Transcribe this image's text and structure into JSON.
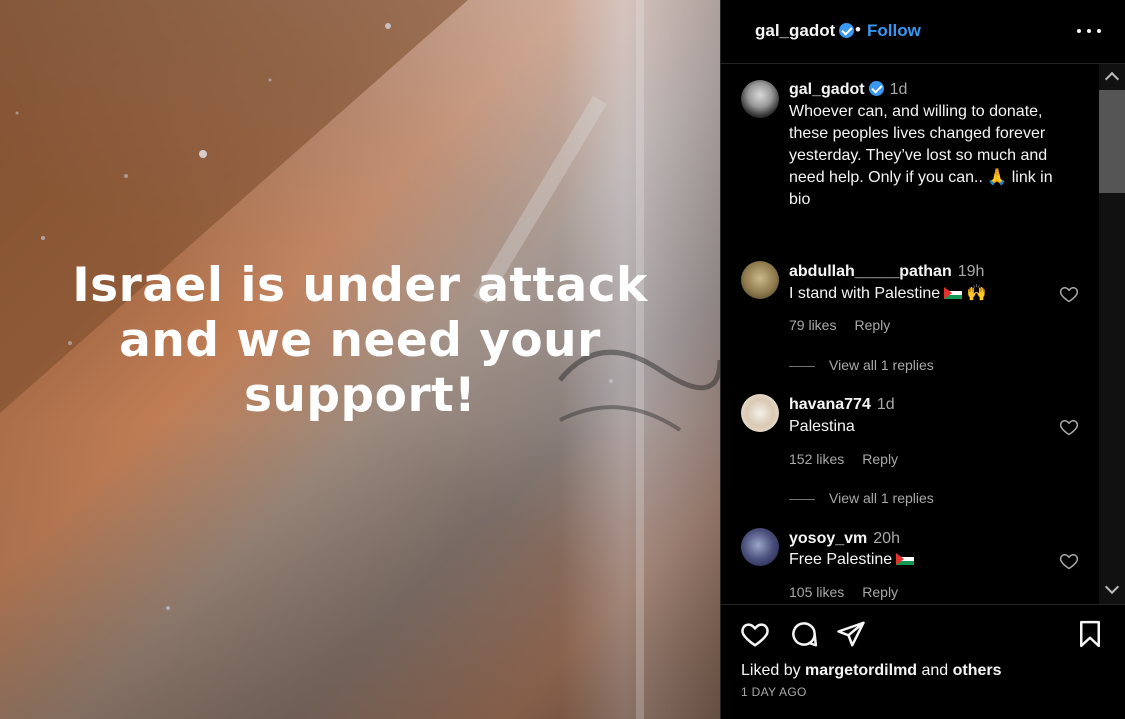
{
  "post": {
    "headline_lines": [
      "Israel is under attack",
      "and we need your",
      "support!"
    ]
  },
  "header": {
    "username": "gal_gadot",
    "separator": "•",
    "follow_label": "Follow"
  },
  "caption": {
    "username": "gal_gadot",
    "time": "1d",
    "text_lines": [
      "Whoever can, and willing to donate,",
      "these peoples lives changed forever",
      "yesterday. They’ve lost so much and",
      "need help. Only if you can.. 🙏 link in",
      "bio"
    ]
  },
  "comments": [
    {
      "username": "abdullah_____pathan",
      "time": "19h",
      "text": "I stand with Palestine",
      "emoji_after_flag": "🙌",
      "likes": "79 likes",
      "reply": "Reply",
      "view_replies": "View all 1 replies"
    },
    {
      "username": "havana774",
      "time": "1d",
      "text": "Palestina",
      "likes": "152 likes",
      "reply": "Reply",
      "view_replies": "View all 1 replies"
    },
    {
      "username": "yosoy_vm",
      "time": "20h",
      "text": "Free Palestine",
      "likes": "105 likes",
      "reply": "Reply"
    }
  ],
  "footer": {
    "liked_prefix": "Liked by ",
    "liked_user": "margetordilmd",
    "liked_mid": " and ",
    "liked_others": "others",
    "time_ago": "1 DAY AGO"
  },
  "icons": {
    "like": "heart-icon",
    "comment": "comment-icon",
    "share": "share-icon",
    "save": "bookmark-icon",
    "more": "more-icon"
  },
  "colors": {
    "background": "#000000",
    "accent": "#3897f0",
    "muted": "#a8a8a8",
    "divider": "#262626"
  }
}
